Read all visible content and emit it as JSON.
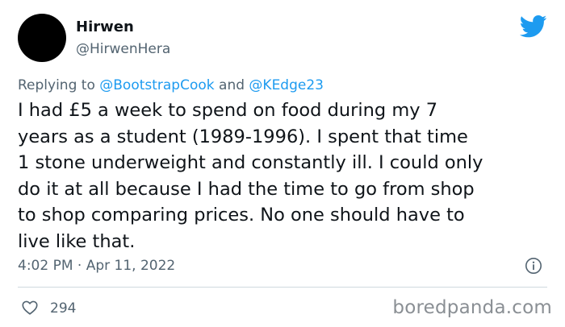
{
  "tweet": {
    "author_name": "Hirwen",
    "author_handle": "@HirwenHera",
    "reply_prefix": "Replying to ",
    "reply_mention_1": "@BootstrapCook",
    "reply_connector": " and ",
    "reply_mention_2": "@KEdge23",
    "body_lines": [
      "I had £5 a week to spend on food during my 7",
      "years as a student (1989-1996). I spent that time",
      "1 stone underweight and constantly ill. I could only",
      "do it at all because I had the time to go from shop",
      "to shop comparing prices. No one should have to",
      "live like that."
    ],
    "timestamp": "4:02 PM · Apr 11, 2022",
    "likes": "294"
  },
  "icons": {
    "avatar": "avatar-black-circle",
    "platform": "twitter-bird-icon",
    "info": "info-icon",
    "like": "heart-icon"
  },
  "colors": {
    "accent": "#1d9bf0",
    "text": "#0f1419",
    "muted": "#536471",
    "divider": "#cfd9de",
    "watermark": "#8a8f94"
  },
  "watermark": "boredpanda.com"
}
